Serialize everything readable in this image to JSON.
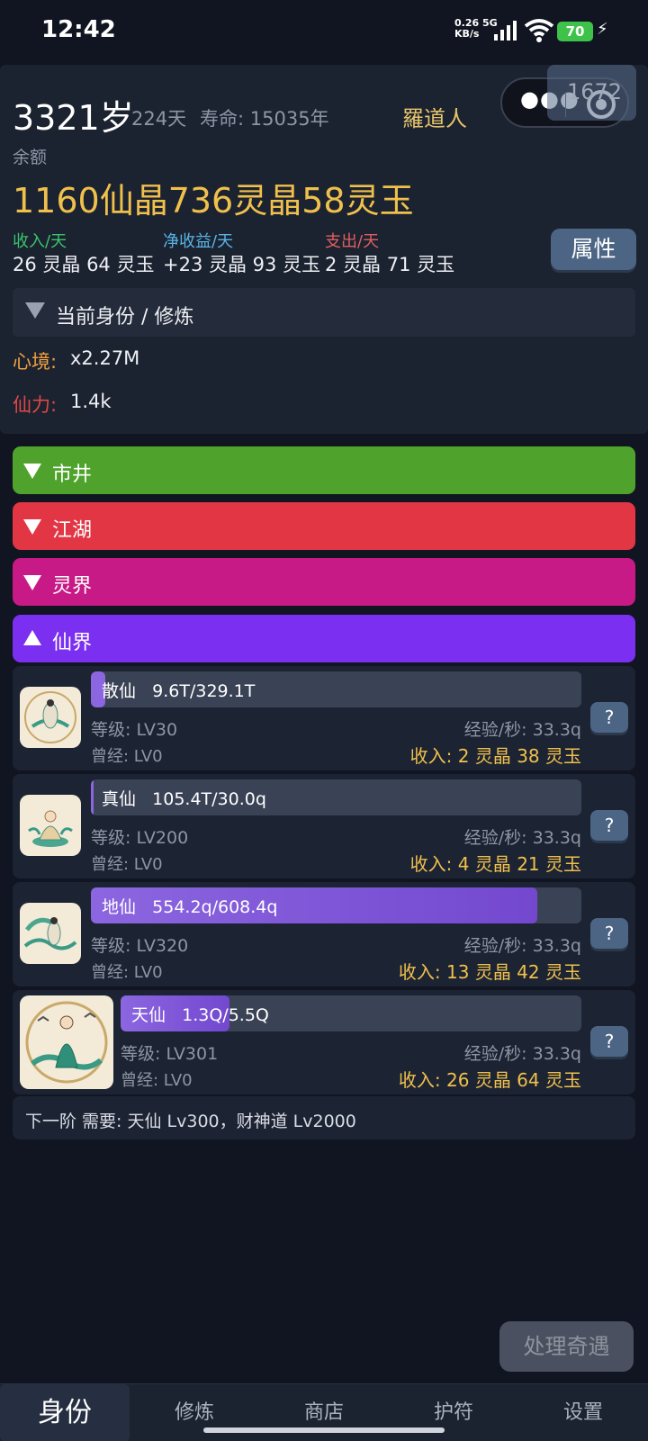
{
  "status_bar": {
    "time": "12:42",
    "net_speed": "0.26",
    "net_unit": "KB/s",
    "net_type": "5G",
    "battery": "70"
  },
  "header": {
    "age": "3321岁",
    "days": "224天",
    "lifespan": "寿命: 15035年",
    "name": "羅道人",
    "fps_overlay": "1672",
    "balance_label": "余额",
    "balance": "1160仙晶736灵晶58灵玉",
    "income_label": "收入/天",
    "income_value": "26 灵晶 64 灵玉",
    "net_label": "净收益/天",
    "net_value": "+23 灵晶 93 灵玉",
    "expense_label": "支出/天",
    "expense_value": "2 灵晶 71 灵玉",
    "attr_button": "属性",
    "identity_section": "当前身份 / 修炼",
    "mind_label": "心境:",
    "mind_value": "x2.27M",
    "power_label": "仙力:",
    "power_value": "1.4k",
    "colors": {
      "income": "#3cc46a",
      "net": "#5ab4e6",
      "expense": "#e06060",
      "mind": "#f0a040",
      "power": "#e04848"
    }
  },
  "categories": [
    {
      "label": "市井",
      "color": "#4fa32c",
      "expanded": false
    },
    {
      "label": "江湖",
      "color": "#e23645",
      "expanded": false
    },
    {
      "label": "灵界",
      "color": "#c81a86",
      "expanded": false
    },
    {
      "label": "仙界",
      "color": "#7b2ff0",
      "expanded": true
    }
  ],
  "jobs": [
    {
      "title": "散仙",
      "progress_text": "9.6T/329.1T",
      "progress": 0.029,
      "level": "等级: LV30",
      "exp": "经验/秒: 33.3q",
      "once": "曾经: LV0",
      "income": "收入: 2 灵晶 38 灵玉",
      "help": "?"
    },
    {
      "title": "真仙",
      "progress_text": "105.4T/30.0q",
      "progress": 0.0035,
      "level": "等级: LV200",
      "exp": "经验/秒: 33.3q",
      "once": "曾经: LV0",
      "income": "收入: 4 灵晶 21 灵玉",
      "help": "?"
    },
    {
      "title": "地仙",
      "progress_text": "554.2q/608.4q",
      "progress": 0.911,
      "level": "等级: LV320",
      "exp": "经验/秒: 33.3q",
      "once": "曾经: LV0",
      "income": "收入: 13 灵晶 42 灵玉",
      "help": "?"
    },
    {
      "title": "天仙",
      "progress_text": "1.3Q/5.5Q",
      "progress": 0.236,
      "level": "等级: LV301",
      "exp": "经验/秒: 33.3q",
      "once": "曾经: LV0",
      "income": "收入: 26 灵晶 64 灵玉",
      "help": "?"
    }
  ],
  "next_tier": "下一阶 需要: 天仙 Lv300，财神道 Lv2000",
  "event_button": "处理奇遇",
  "nav": [
    "身份",
    "修炼",
    "商店",
    "护符",
    "设置"
  ]
}
